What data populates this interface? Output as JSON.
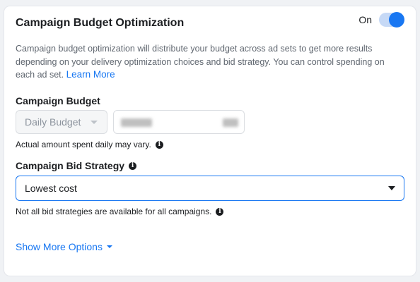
{
  "card": {
    "title": "Campaign Budget Optimization",
    "toggle": {
      "label": "On",
      "state": "on",
      "color": "#1877f2"
    },
    "description": "Campaign budget optimization will distribute your budget across ad sets to get more results depending on your delivery optimization choices and bid strategy. You can control spending on each ad set.",
    "learn_more": "Learn More"
  },
  "budget": {
    "label": "Campaign Budget",
    "type_select": "Daily Budget",
    "note": "Actual amount spent daily may vary."
  },
  "bid": {
    "label": "Campaign Bid Strategy",
    "selected": "Lowest cost",
    "note": "Not all bid strategies are available for all campaigns."
  },
  "show_more": "Show More Options",
  "icons": {
    "info": "info-icon",
    "dropdown": "chevron-down-icon"
  }
}
